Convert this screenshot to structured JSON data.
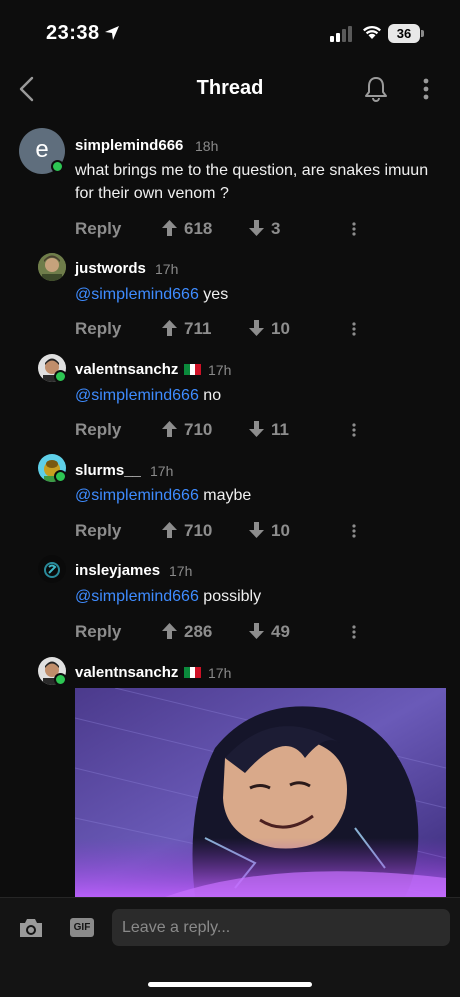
{
  "status": {
    "time": "23:38",
    "battery": "36"
  },
  "header": {
    "title": "Thread"
  },
  "comments": [
    {
      "avatar_letter": "e",
      "username": "simplemind666",
      "time": "18h",
      "text": "what brings me to the question, are snakes imuun for their own venom ?",
      "reply": "Reply",
      "upvotes": "618",
      "downvotes": "3"
    },
    {
      "username": "justwords",
      "time": "17h",
      "mention": "@simplemind666",
      "text": " yes",
      "reply": "Reply",
      "upvotes": "711",
      "downvotes": "10"
    },
    {
      "username": "valentnsanchz",
      "time": "17h",
      "mention": "@simplemind666",
      "text": " no",
      "reply": "Reply",
      "upvotes": "710",
      "downvotes": "11"
    },
    {
      "username": "slurms__",
      "time": "17h",
      "mention": "@simplemind666",
      "text": " maybe",
      "reply": "Reply",
      "upvotes": "710",
      "downvotes": "10"
    },
    {
      "username": "insleyjames",
      "time": "17h",
      "mention": "@simplemind666",
      "text": " possibly",
      "reply": "Reply",
      "upvotes": "286",
      "downvotes": "49"
    },
    {
      "username": "valentnsanchz",
      "time": "17h"
    }
  ],
  "composer": {
    "gif_label": "GIF",
    "placeholder": "Leave a reply..."
  },
  "colors": {
    "background": "#0d0d0d",
    "mention": "#3f8cff",
    "online": "#2dc653",
    "muted": "#8d8d8d"
  }
}
